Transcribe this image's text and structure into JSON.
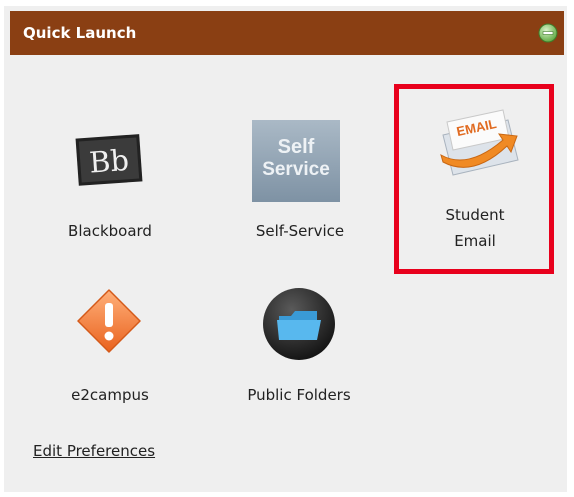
{
  "header": {
    "title": "Quick Launch",
    "collapse_icon": "minus-circle-icon"
  },
  "tiles": [
    {
      "label": "Blackboard",
      "icon": "blackboard-logo-icon"
    },
    {
      "label": "Self-Service",
      "icon": "self-service-icon",
      "icon_text_1": "Self",
      "icon_text_2": "Service"
    },
    {
      "label_line1": "Student",
      "label_line2": "Email",
      "icon": "email-envelope-icon",
      "icon_text": "EMAIL",
      "highlighted": true
    },
    {
      "label": "e2campus",
      "icon": "alert-diamond-icon"
    },
    {
      "label": "Public Folders",
      "icon": "folder-icon"
    }
  ],
  "footer": {
    "edit_preferences": "Edit Preferences"
  },
  "colors": {
    "header": "#8a3f13",
    "highlight": "#e8001c",
    "panel": "#efefef"
  }
}
